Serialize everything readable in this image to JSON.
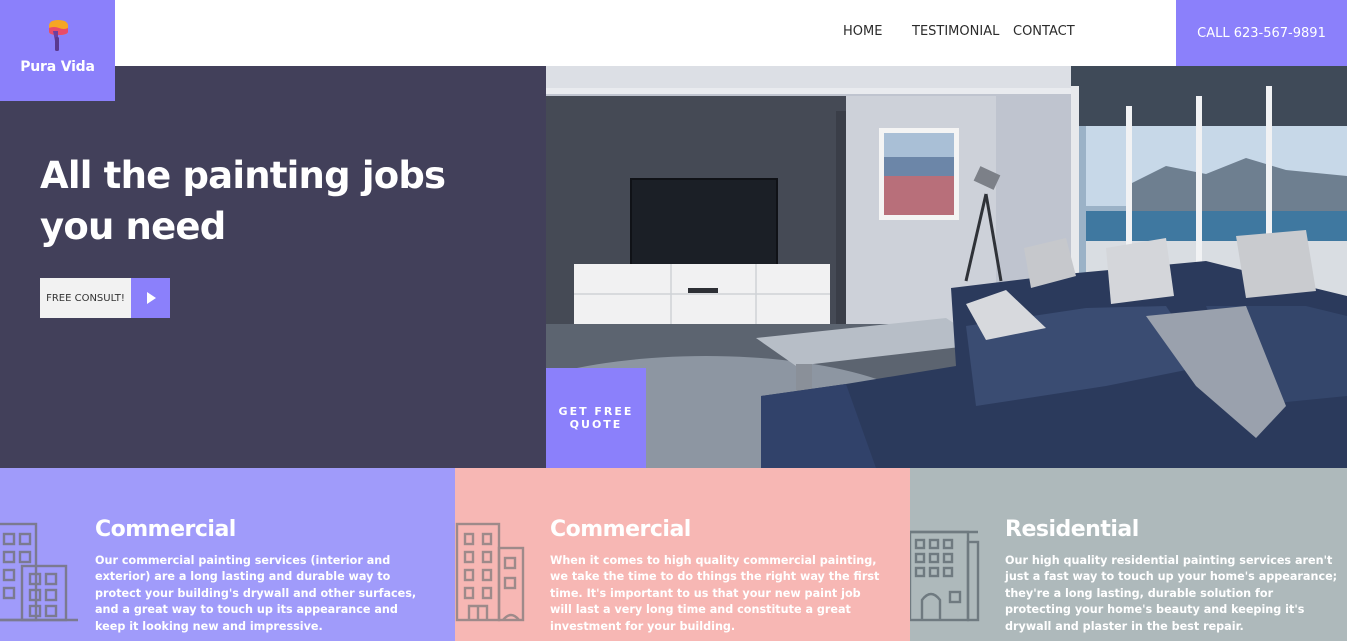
{
  "brand": {
    "name": "Pura Vida",
    "accent": "#8b80fb",
    "logo_icon": "paint-roller-icon"
  },
  "nav": {
    "home": "HOME",
    "testimonial": "TESTIMONIAL",
    "contact": "CONTACT",
    "call": "CALL 623-567-9891"
  },
  "hero": {
    "title": "All the painting jobs you need",
    "consult_label": "FREE CONSULT!",
    "play_icon": "play-icon",
    "quote_label": "GET FREE QUOTE",
    "background_color": "#42405a",
    "photo": "living-room-photo"
  },
  "services": [
    {
      "title": "Commercial",
      "icon": "office-building-icon",
      "color": "#a09bfa",
      "text": "Our commercial painting services (interior and exterior) are a long lasting and durable way to protect your building's drywall and other surfaces, and a great way to touch up its appearance and keep it looking new and impressive."
    },
    {
      "title": "Commercial",
      "icon": "office-tower-icon",
      "color": "#f7b7b4",
      "text": "When it comes to high quality commercial painting, we take the time to do things the right way the first time. It's important to us that your new paint job will last a very long time and constitute a great investment for your building."
    },
    {
      "title": "Residential",
      "icon": "house-building-icon",
      "color": "#aeb9bb",
      "text": "Our high quality residential painting services aren't just a fast way to touch up your home's appearance; they're a long lasting, durable solution for protecting your home's beauty and keeping it's drywall and plaster in the best repair."
    }
  ]
}
